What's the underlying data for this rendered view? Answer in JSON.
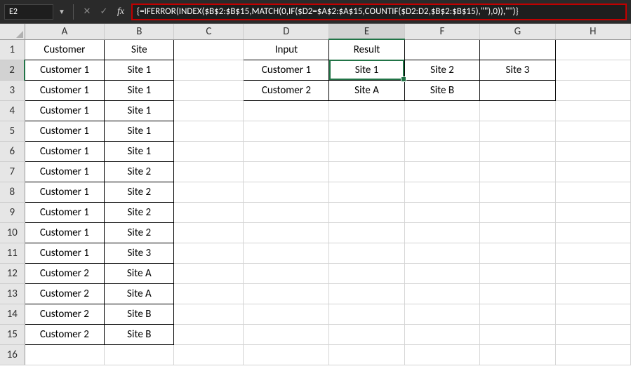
{
  "name_box": "E2",
  "formula": "{=IFERROR(INDEX($B$2:$B$15,MATCH(0,IF($D2=$A$2:$A$15,COUNTIF($D2:D2,$B$2:$B$15),\"\"),0)),\"\")}",
  "columns": [
    "A",
    "B",
    "C",
    "D",
    "E",
    "F",
    "G",
    "H"
  ],
  "rows": [
    "1",
    "2",
    "3",
    "4",
    "5",
    "6",
    "7",
    "8",
    "9",
    "10",
    "11",
    "12",
    "13",
    "14",
    "15",
    "16"
  ],
  "active_cell": "E2",
  "cells": {
    "A1": "Customer",
    "B1": "Site",
    "A2": "Customer 1",
    "B2": "Site 1",
    "A3": "Customer 1",
    "B3": "Site 1",
    "A4": "Customer 1",
    "B4": "Site 1",
    "A5": "Customer 1",
    "B5": "Site 1",
    "A6": "Customer 1",
    "B6": "Site 1",
    "A7": "Customer 1",
    "B7": "Site 2",
    "A8": "Customer 1",
    "B8": "Site 2",
    "A9": "Customer 1",
    "B9": "Site 2",
    "A10": "Customer 1",
    "B10": "Site 2",
    "A11": "Customer 1",
    "B11": "Site 3",
    "A12": "Customer 2",
    "B12": "Site A",
    "A13": "Customer 2",
    "B13": "Site A",
    "A14": "Customer 2",
    "B14": "Site B",
    "A15": "Customer 2",
    "B15": "Site B",
    "D1": "Input",
    "E1": "Result",
    "D2": "Customer 1",
    "E2": "Site 1",
    "F2": "Site 2",
    "G2": "Site 3",
    "D3": "Customer 2",
    "E3": "Site A",
    "F3": "Site B"
  },
  "bordered_ranges": [
    [
      "A1",
      "B15"
    ],
    [
      "D1",
      "G3"
    ]
  ],
  "chart_data": {
    "type": "table",
    "source": [
      {
        "Customer": "Customer 1",
        "Site": "Site 1"
      },
      {
        "Customer": "Customer 1",
        "Site": "Site 1"
      },
      {
        "Customer": "Customer 1",
        "Site": "Site 1"
      },
      {
        "Customer": "Customer 1",
        "Site": "Site 1"
      },
      {
        "Customer": "Customer 1",
        "Site": "Site 1"
      },
      {
        "Customer": "Customer 1",
        "Site": "Site 2"
      },
      {
        "Customer": "Customer 1",
        "Site": "Site 2"
      },
      {
        "Customer": "Customer 1",
        "Site": "Site 2"
      },
      {
        "Customer": "Customer 1",
        "Site": "Site 2"
      },
      {
        "Customer": "Customer 1",
        "Site": "Site 3"
      },
      {
        "Customer": "Customer 2",
        "Site": "Site A"
      },
      {
        "Customer": "Customer 2",
        "Site": "Site A"
      },
      {
        "Customer": "Customer 2",
        "Site": "Site B"
      },
      {
        "Customer": "Customer 2",
        "Site": "Site B"
      }
    ],
    "result": [
      {
        "Input": "Customer 1",
        "Result": [
          "Site 1",
          "Site 2",
          "Site 3"
        ]
      },
      {
        "Input": "Customer 2",
        "Result": [
          "Site A",
          "Site B"
        ]
      }
    ]
  }
}
